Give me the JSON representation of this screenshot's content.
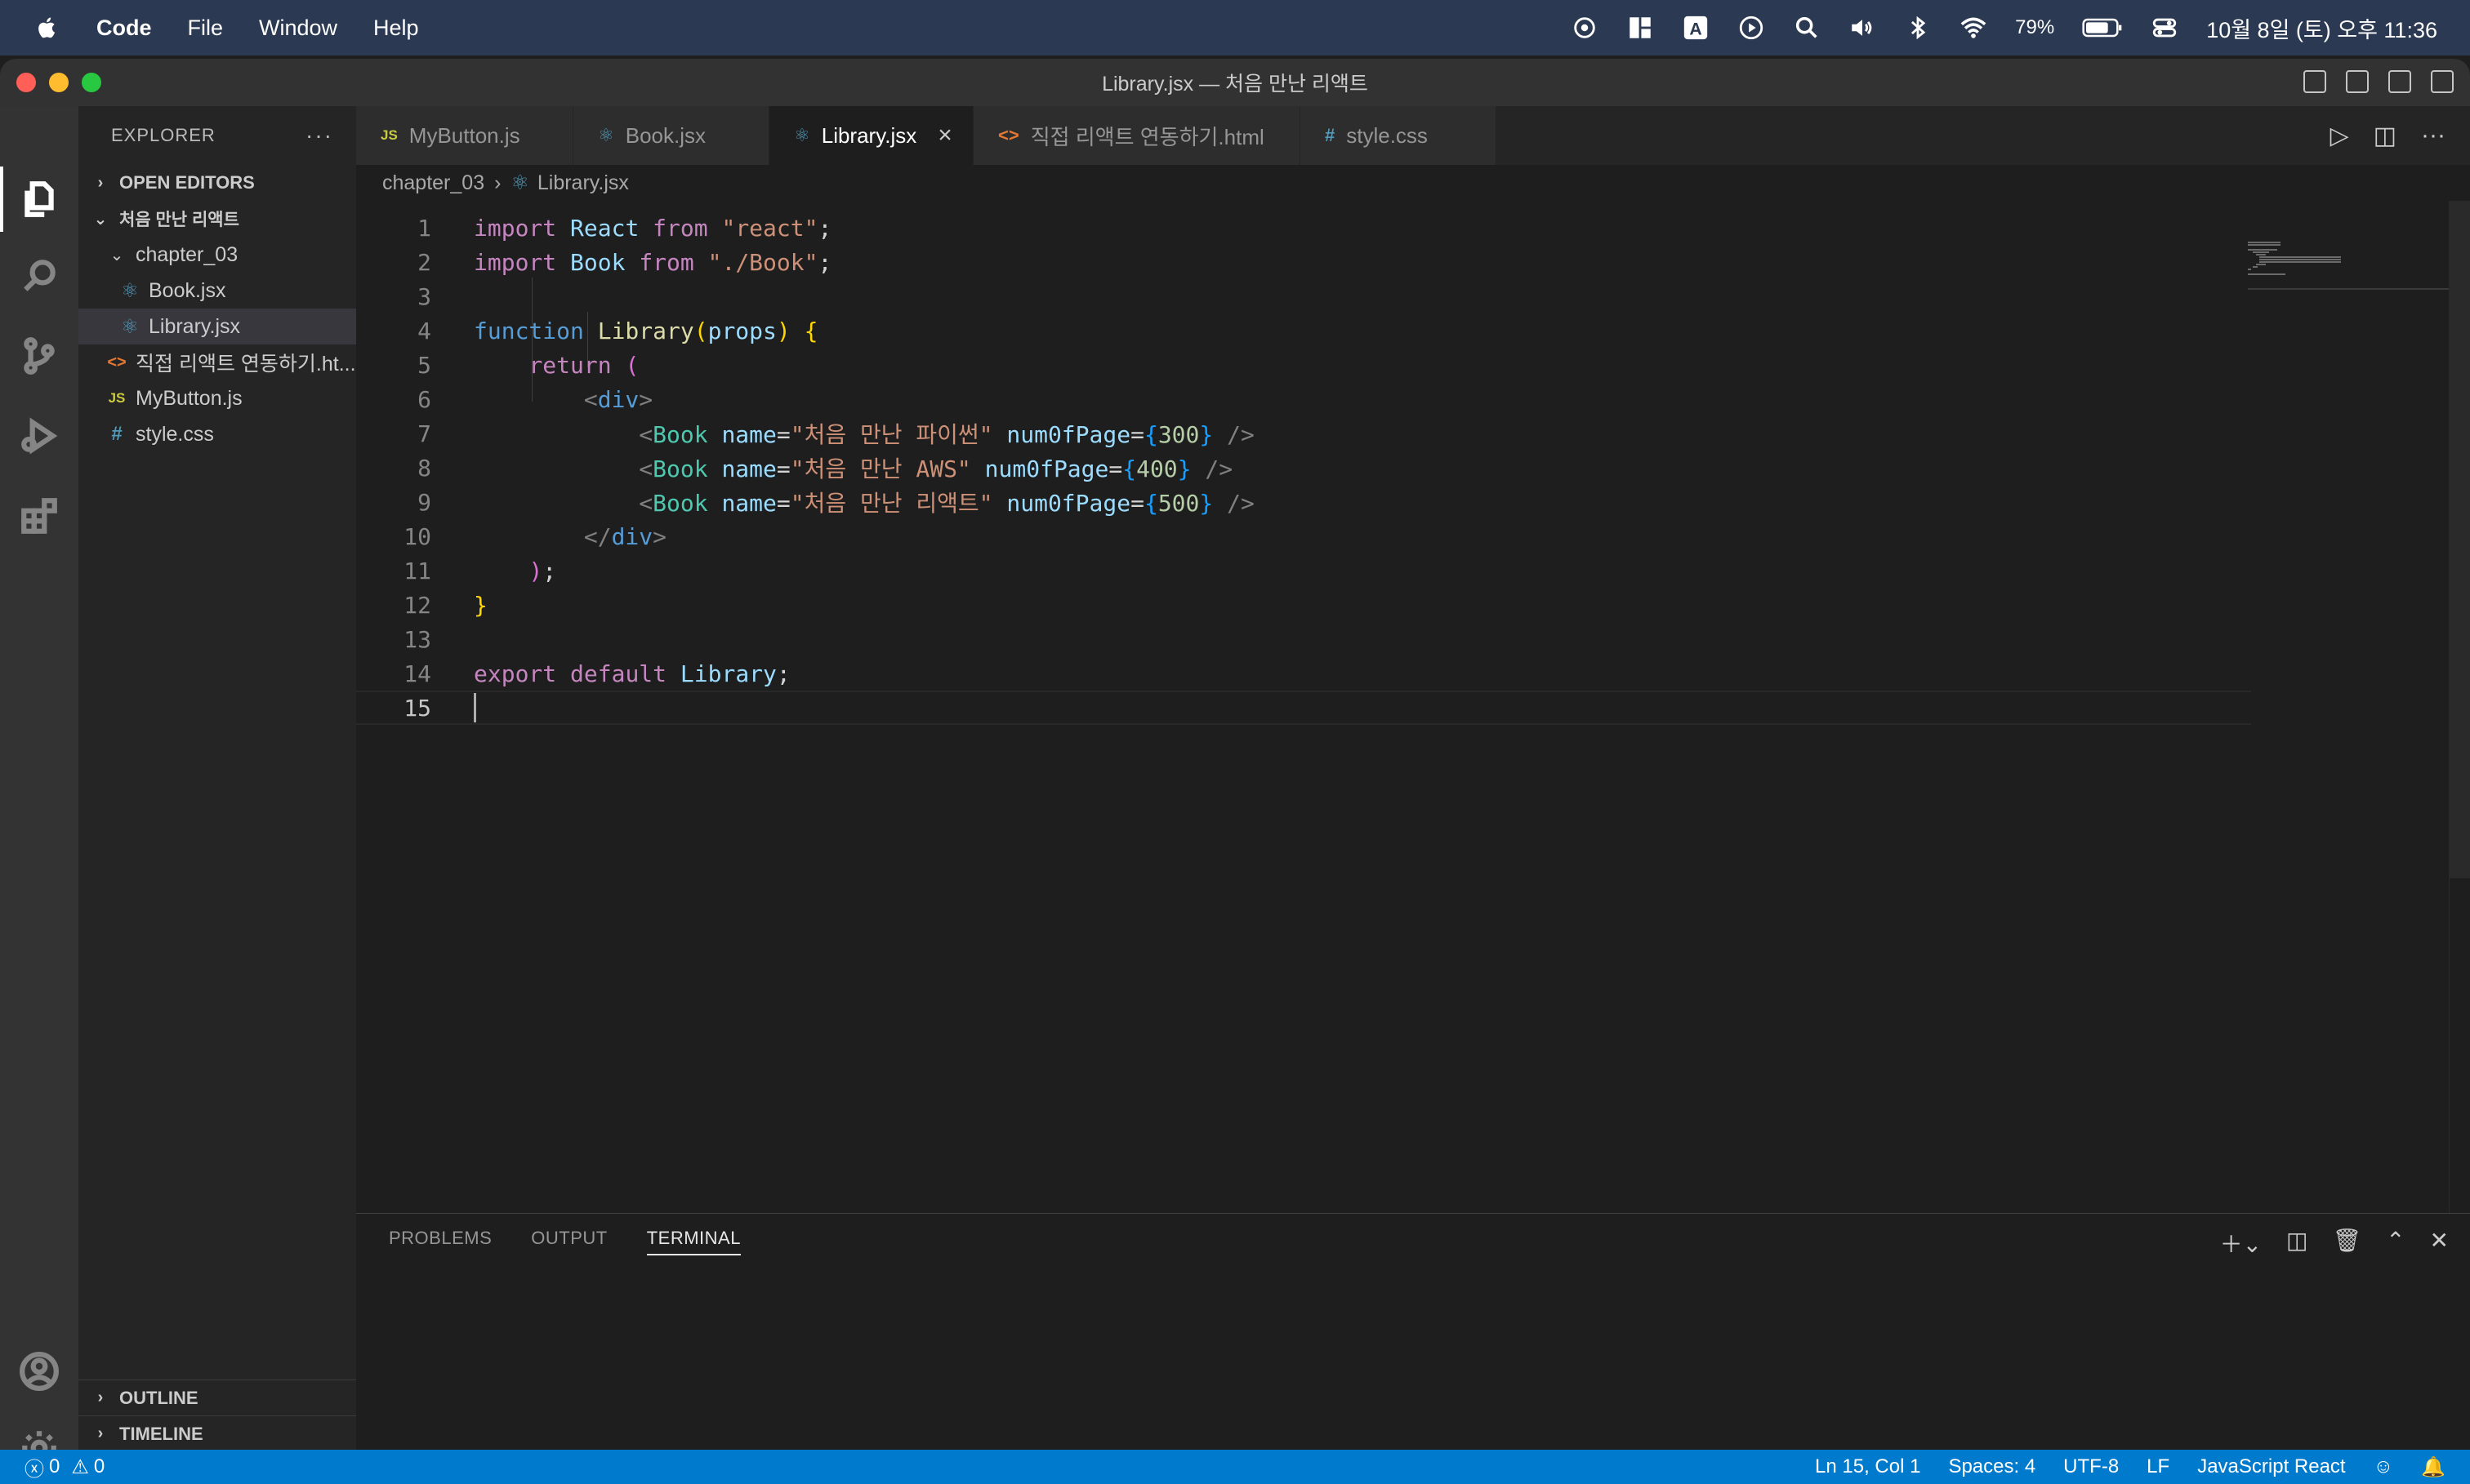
{
  "menubar": {
    "app": "Code",
    "items": [
      "File",
      "Window",
      "Help"
    ],
    "battery": "79%",
    "datetime": "10월 8일 (토) 오후 11:36"
  },
  "window": {
    "title": "Library.jsx — 처음 만난 리액트"
  },
  "sidebar": {
    "header": "EXPLORER",
    "open_editors": "OPEN EDITORS",
    "project": "처음 만난 리액트",
    "folder": "chapter_03",
    "files_in_folder": [
      "Book.jsx",
      "Library.jsx"
    ],
    "root_files": [
      "직접 리액트 연동하기.ht...",
      "MyButton.js",
      "style.css"
    ],
    "outline": "OUTLINE",
    "timeline": "TIMELINE"
  },
  "tabs": [
    {
      "label": "MyButton.js",
      "icon": "JS"
    },
    {
      "label": "Book.jsx",
      "icon": "⚛"
    },
    {
      "label": "Library.jsx",
      "icon": "⚛"
    },
    {
      "label": "직접 리액트 연동하기.html",
      "icon": "<>"
    },
    {
      "label": "style.css",
      "icon": "#"
    }
  ],
  "breadcrumb": [
    "chapter_03",
    "Library.jsx"
  ],
  "editor": {
    "line_numbers": [
      "1",
      "2",
      "3",
      "4",
      "5",
      "6",
      "7",
      "8",
      "9",
      "10",
      "11",
      "12",
      "13",
      "14",
      "15"
    ],
    "l1": {
      "a": "import",
      "b": "React",
      "c": "from",
      "d": "\"react\"",
      "e": ";"
    },
    "l2": {
      "a": "import",
      "b": "Book",
      "c": "from",
      "d": "\"./Book\"",
      "e": ";"
    },
    "l4": {
      "a": "function",
      "b": "Library",
      "c": "(",
      "d": "props",
      "e": ")",
      "f": "{"
    },
    "l5": {
      "a": "return",
      "b": "("
    },
    "l6": {
      "a": "<",
      "b": "div",
      "c": ">"
    },
    "l7": {
      "name_value": "\"처음 만난 파이썬\"",
      "num": "300"
    },
    "l8": {
      "name_value": "\"처음 만난 AWS\"",
      "num": "400"
    },
    "l9": {
      "name_value": "\"처음 만난 리액트\"",
      "num": "500"
    },
    "jsx": {
      "lt": "<",
      "tag": "Book",
      "attr1": "name",
      "eq": "=",
      "attr2": "num0fPage",
      "ob": "{",
      "cb": "}",
      "selfclose": "/>"
    },
    "l10": {
      "a": "</",
      "b": "div",
      "c": ">"
    },
    "l11": {
      "a": ")",
      "b": ";"
    },
    "l12": {
      "a": "}"
    },
    "l14": {
      "a": "export",
      "b": "default",
      "c": "Library",
      "d": ";"
    }
  },
  "panel": {
    "tabs": [
      "PROBLEMS",
      "OUTPUT",
      "TERMINAL"
    ],
    "active": "TERMINAL"
  },
  "statusbar": {
    "errors": "0",
    "warnings": "0",
    "position": "Ln 15, Col 1",
    "spaces": "Spaces: 4",
    "encoding": "UTF-8",
    "eol": "LF",
    "language": "JavaScript React"
  }
}
